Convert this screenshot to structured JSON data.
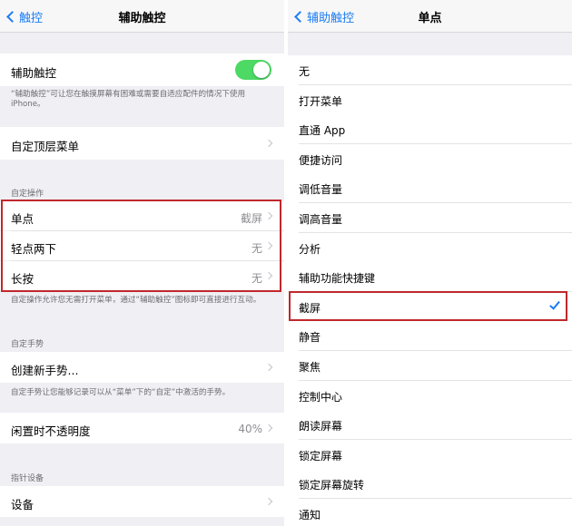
{
  "left": {
    "nav": {
      "back_label": "触控",
      "title": "辅助触控"
    },
    "assistive": {
      "label": "辅助触控",
      "toggle_on": true,
      "note": "“辅助触控”可让您在触摸屏幕有困难或需要自适应配件的情况下使用iPhone。"
    },
    "customize_top_menu": {
      "label": "自定顶层菜单"
    },
    "custom_actions": {
      "header": "自定操作",
      "items": [
        {
          "label": "单点",
          "value": "截屏"
        },
        {
          "label": "轻点两下",
          "value": "无"
        },
        {
          "label": "长按",
          "value": "无"
        }
      ],
      "note": "自定操作允许您无需打开菜单，通过“辅助触控”图标即可直接进行互动。"
    },
    "custom_gestures": {
      "header": "自定手势",
      "create_label": "创建新手势...",
      "note": "自定手势让您能够记录可以从“菜单”下的“自定”中激活的手势。"
    },
    "idle_opacity": {
      "label": "闲置时不透明度",
      "value": "40%"
    },
    "pointer_devices": {
      "header": "指针设备",
      "devices_label": "设备"
    }
  },
  "right": {
    "nav": {
      "back_label": "辅助触控",
      "title": "单点"
    },
    "options": [
      "无",
      "打开菜单",
      "直通 App",
      "便捷访问",
      "调低音量",
      "调高音量",
      "分析",
      "辅助功能快捷键",
      "截屏",
      "静音",
      "聚焦",
      "控制中心",
      "朗读屏幕",
      "锁定屏幕",
      "锁定屏幕旋转",
      "通知"
    ],
    "selected": "截屏"
  },
  "colors": {
    "accent": "#1a7cf5",
    "toggle_on": "#4cd964",
    "highlight": "#c0282c"
  }
}
